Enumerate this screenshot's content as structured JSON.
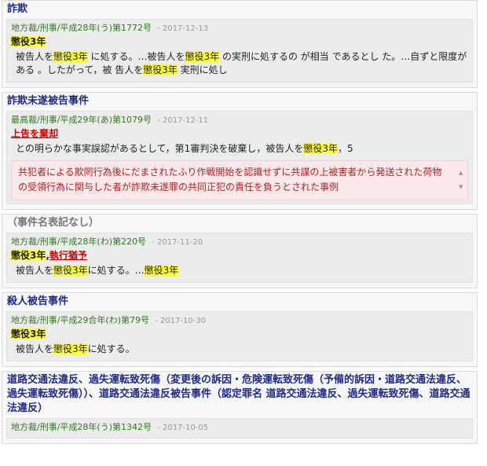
{
  "results": [
    {
      "title": "詐欺",
      "court": "地方裁/刑事/平成28年(う)第1772号",
      "date": "2017-12-13",
      "sentence": "懲役3年",
      "excerpt": [
        "被告人を",
        "懲役3年",
        " に処する。…被告人を",
        "懲役3年",
        " の実刑に処するの が相当 であるとし た。…自ずと限度がある 。したがって，被 告人を",
        "懲役3年",
        " 実刑に処し"
      ]
    },
    {
      "title": "詐欺未遂被告事件",
      "court": "最高裁/刑事/平成29年(あ)第1079号",
      "date": "2017-12-11",
      "result": "上告を棄却",
      "excerpt": [
        "との明らかな事実誤認があるとして，第1審判決を破棄し，被告人を",
        "懲役3年",
        "，5"
      ],
      "summary": "共犯者による欺罔行為後にだまされたふり作戦開始を認識せずに共謀の上被害者から発送された荷物の受領行為に関与した者が詐欺未遂罪の共同正犯の責任を負うとされた事例"
    },
    {
      "title": "（事件名表記なし）",
      "court": "地方裁/刑事/平成28年(わ)第220号",
      "date": "2017-11-20",
      "sentence": "懲役3年",
      "suspension": "執行猶予",
      "excerpt": [
        "被告人を",
        "懲役3年",
        "に処する。…",
        "懲役3年"
      ]
    },
    {
      "title": "殺人被告事件",
      "court": "地方裁/刑事/平成29合年(わ)第79号",
      "date": "2017-10-30",
      "sentence": "懲役3年",
      "excerpt": [
        "被告人を",
        "懲役3年",
        "に処する。"
      ]
    },
    {
      "title": "道路交通法違反、過失運転致死傷（変更後の訴因・危険運転致死傷（予備的訴因・道路交通法違反、過失運転致死傷））、道路交通法違反被告事件（認定罪名 道路交通法違反、過失運転致死傷、道路交通法違反）",
      "court": "地方裁/刑事/平成28年(う)第1342号",
      "date": "2017-10-05"
    }
  ],
  "icons": {
    "scroll_up": "triangle-up-icon",
    "scroll_down": "triangle-down-icon"
  },
  "colors": {
    "title": "#1e2a8c",
    "court": "#2f7a1f",
    "highlight": "#ffff33",
    "result": "#d40000",
    "summary_bg": "#fbe8ea"
  }
}
